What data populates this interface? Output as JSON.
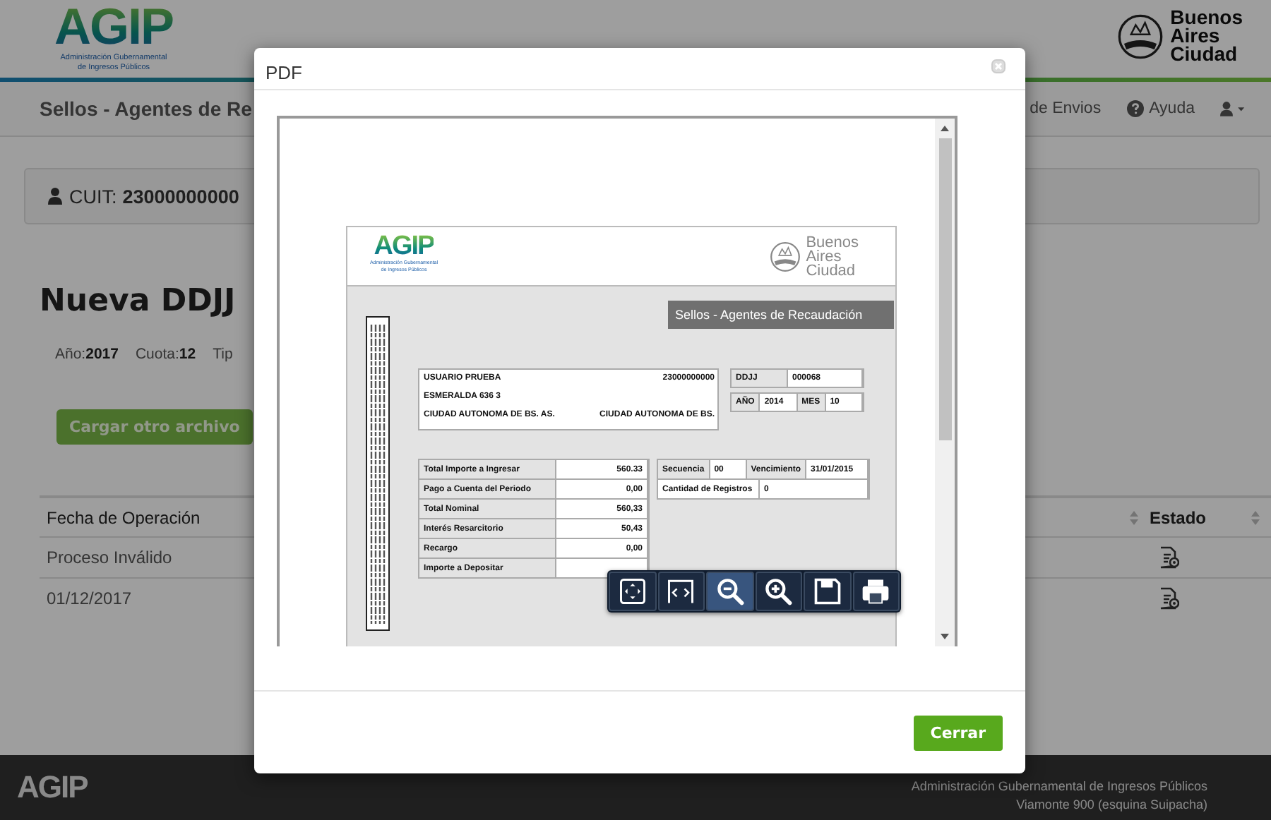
{
  "header": {
    "logo": "AGIP",
    "logo_subtitle": [
      "Administración Gubernamental",
      "de Ingresos Públicos"
    ],
    "city_logo": [
      "Buenos",
      "Aires",
      "Ciudad"
    ]
  },
  "navbar": {
    "title": "Sellos - Agentes de Re",
    "items": [
      {
        "kind": "text",
        "label": "de Envios"
      },
      {
        "kind": "help",
        "label": "Ayuda"
      },
      {
        "kind": "user"
      }
    ]
  },
  "cuit": {
    "label": "CUIT:",
    "value": "23000000000"
  },
  "page_title": "Nueva DDJJ",
  "details": [
    {
      "label": "Año:",
      "value": "2017"
    },
    {
      "label": "Cuota:",
      "value": "12"
    },
    {
      "label": "Tip"
    }
  ],
  "upload_button": "Cargar otro archivo",
  "table": {
    "columns": [
      "Fecha de Operación",
      "Estado"
    ],
    "rows": [
      {
        "cells": [
          "Proceso Inválido"
        ]
      },
      {
        "cells": [
          "01/12/2017"
        ]
      }
    ]
  },
  "footer": {
    "logo": "AGIP",
    "lines": [
      "Administración Gubernamental de Ingresos Públicos",
      "Viamonte 900 (esquina Suipacha)"
    ]
  },
  "modal": {
    "title": "PDF",
    "close_button": "Cerrar",
    "document": {
      "logo": "AGIP",
      "logo_subtitle": [
        "Administración Gubernamental",
        "de Ingresos Públicos"
      ],
      "city_logo": [
        "Buenos",
        "Aires",
        "Ciudad"
      ],
      "banner": "Sellos - Agentes de Recaudación",
      "taxpayer": {
        "name": "USUARIO PRUEBA",
        "cuit": "23000000000",
        "address": "ESMERALDA 636 3",
        "city": "CIUDAD AUTONOMA DE BS. AS.",
        "province": "CIUDAD AUTONOMA DE BS."
      },
      "ddjj": {
        "label": "DDJJ",
        "value": "000068"
      },
      "period": [
        {
          "label": "AÑO",
          "value": "2014"
        },
        {
          "label": "MES",
          "value": "10"
        }
      ],
      "amounts": [
        {
          "label": "Total Importe a Ingresar",
          "value": "560.33"
        },
        {
          "label": "Pago a Cuenta del Periodo",
          "value": "0,00"
        },
        {
          "label": "Total Nominal",
          "value": "560,33"
        },
        {
          "label": "Interés Resarcitorio",
          "value": "50,43"
        },
        {
          "label": "Recargo",
          "value": "0,00"
        },
        {
          "label": "Importe a Depositar"
        }
      ],
      "sequence": [
        {
          "label": "Secuencia",
          "value": "00"
        },
        {
          "label": "Vencimiento",
          "value": "31/01/2015"
        }
      ],
      "records": {
        "label": "Cantidad de Registros",
        "value": "0"
      }
    },
    "toolbar": [
      {
        "kind": "fit",
        "highlighted": false
      },
      {
        "kind": "width",
        "highlighted": false
      },
      {
        "kind": "zoom-out",
        "highlighted": true
      },
      {
        "kind": "zoom-in",
        "highlighted": false
      },
      {
        "kind": "save",
        "highlighted": false
      },
      {
        "kind": "print",
        "highlighted": false
      }
    ]
  }
}
